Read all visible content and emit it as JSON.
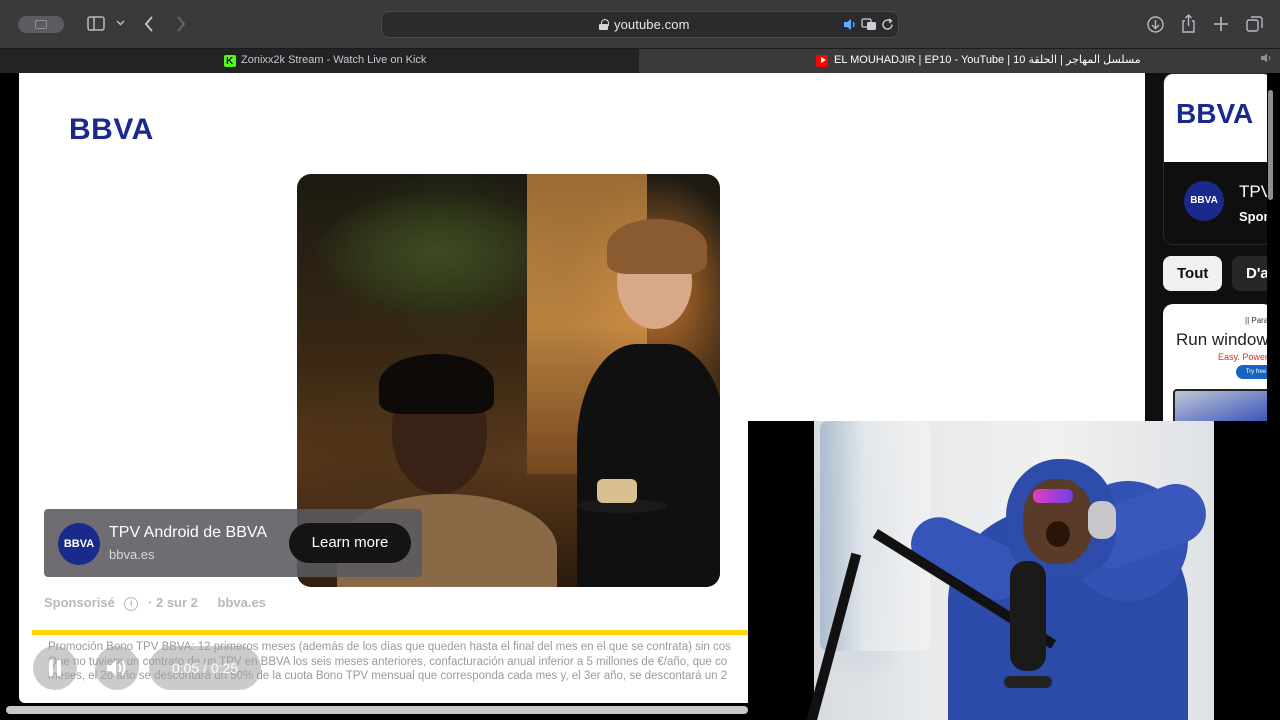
{
  "browser": {
    "url": "youtube.com",
    "tabs": [
      {
        "title": "Zonixx2k Stream - Watch Live on Kick",
        "active": false
      },
      {
        "title": "EL MOUHADJIR | EP10 - YouTube | مسلسل المهاجر | الحلقة 10",
        "active": true
      }
    ]
  },
  "ad": {
    "brand_logo": "BBVA",
    "card": {
      "logo_text": "BBVA",
      "title": "TPV Android de BBVA",
      "url": "bbva.es",
      "cta": "Learn more"
    },
    "sponsored_label": "Sponsorisé",
    "ad_position": "· 2 sur 2",
    "ad_domain": "bbva.es",
    "legal_lines": [
      "Promoción Bono TPV BBVA: 12 primeros meses (además de los días que queden hasta el final del mes en el que se contrata) sin cos",
      "Que no tuviera un contrato de un TPV en BBVA los seis meses anteriores, confacturación anual inferior a 5 millones de €/año, que co",
      "meses, el 2o año se descontará un 50% de la cuota Bono TPV mensual que corresponda cada mes y, el 3er año, se descontará un 2"
    ],
    "progress_fraction": 1.0,
    "accent_color": "#ffd400"
  },
  "player": {
    "time": "0:05 / 0:25"
  },
  "sidebar": {
    "ad_brand": "BBVA",
    "ad_title": "TPV",
    "ad_sponsored": "Spon",
    "chips": [
      "Tout",
      "D'a"
    ],
    "ad2_brand": "|| Paral",
    "ad2_title": "Run window",
    "ad2_tagline": "Easy. Powerful.",
    "ad2_button": "Try free"
  },
  "icons": [
    "sidebar-toggle-icon",
    "chevron-down-icon",
    "back-icon",
    "forward-icon",
    "lock-icon",
    "audio-icon",
    "translate-icon",
    "reload-icon",
    "download-icon",
    "share-icon",
    "new-tab-icon",
    "tab-overview-icon",
    "pause-icon",
    "volume-icon",
    "info-icon"
  ]
}
